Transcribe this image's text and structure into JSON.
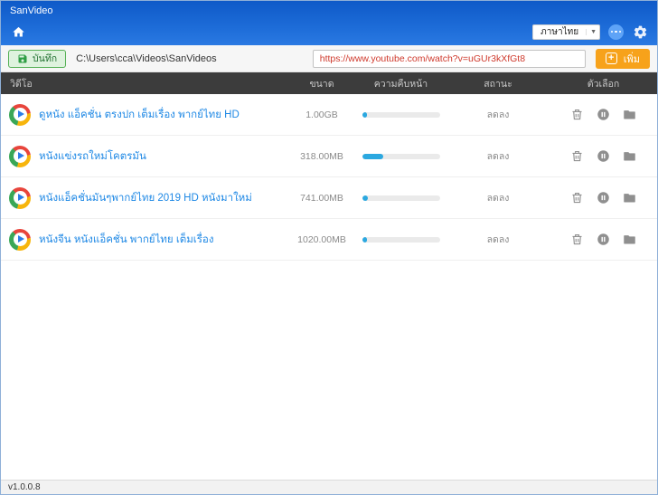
{
  "window": {
    "title": "SanVideo",
    "version": "v1.0.0.8"
  },
  "navbar": {
    "language": "ภาษาไทย"
  },
  "toolbar": {
    "save_label": "บันทึก",
    "save_path": "C:\\Users\\cca\\Videos\\SanVideos",
    "url_value": "https://www.youtube.com/watch?v=uGUr3kXfGt8",
    "add_label": "เพิ่ม"
  },
  "table": {
    "headers": {
      "video": "วิดีโอ",
      "size": "ขนาด",
      "progress": "ความคืบหน้า",
      "status": "สถานะ",
      "options": "ตัวเลือก"
    },
    "rows": [
      {
        "title": "ดูหนัง แอ็คชั่น ตรงปก เต็มเรื่อง พากย์ไทย HD",
        "size": "1.00GB",
        "progress_percent": 6,
        "status": "ลดลง"
      },
      {
        "title": "หนังแข่งรถใหม่โคตรมัน",
        "size": "318.00MB",
        "progress_percent": 27,
        "status": "ลดลง"
      },
      {
        "title": "หนังแอ็คชั่นมันๆพากย์ไทย 2019 HD หนังมาใหม่",
        "size": "741.00MB",
        "progress_percent": 7,
        "status": "ลดลง"
      },
      {
        "title": "หนังจีน หนังแอ็คชั่น พากย์ไทย เต็มเรื่อง",
        "size": "1020.00MB",
        "progress_percent": 6,
        "status": "ลดลง"
      }
    ]
  },
  "colors": {
    "header_blue": "#1d6cd8",
    "table_header_bg": "#3c3c3c",
    "row_title_blue": "#1e88e5",
    "progress_fill": "#2ba8e0",
    "add_orange": "#f7a21b",
    "save_green": "#55b055",
    "url_text_red": "#cf3a2d"
  }
}
